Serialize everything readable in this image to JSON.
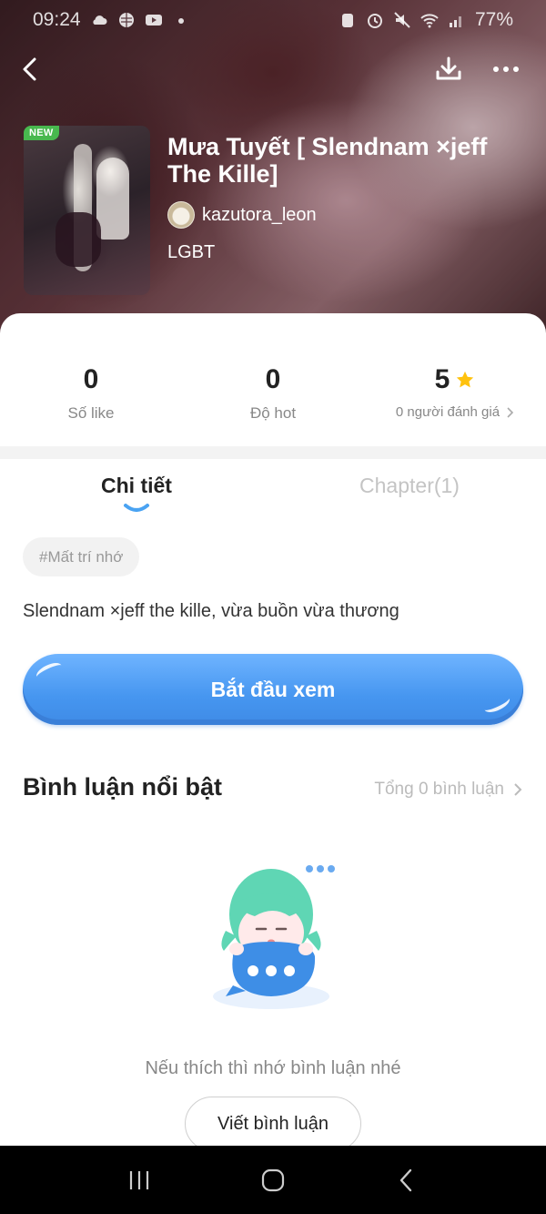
{
  "status_bar": {
    "time": "09:24",
    "battery": "77%"
  },
  "header": {
    "back_icon": "back-arrow-icon",
    "download_icon": "download-icon",
    "more_icon": "more-dots-icon"
  },
  "book": {
    "badge": "NEW",
    "title": "Mưa Tuyết [ Slendnam ×jeff The Kille]",
    "author": "kazutora_leon",
    "genre": "LGBT"
  },
  "stats": {
    "likes_value": "0",
    "likes_label": "Số like",
    "hot_value": "0",
    "hot_label": "Độ hot",
    "rating_value": "5",
    "rating_label": "0 người đánh giá"
  },
  "tabs": {
    "details": "Chi tiết",
    "chapters": "Chapter(1)"
  },
  "tag": "#Mất trí nhớ",
  "description": "Slendnam ×jeff the kille, vừa buồn vừa thương",
  "start_button": "Bắt đầu xem",
  "comments": {
    "title": "Bình luận nổi bật",
    "total": "Tổng 0 bình luận",
    "empty_hint": "Nếu thích thì nhớ bình luận nhé",
    "write_button": "Viết bình luận"
  },
  "colors": {
    "accent_blue": "#4696f0",
    "star_yellow": "#ffc20e",
    "new_badge_green": "#48b84e",
    "mascot_teal": "#5fd6b4"
  }
}
